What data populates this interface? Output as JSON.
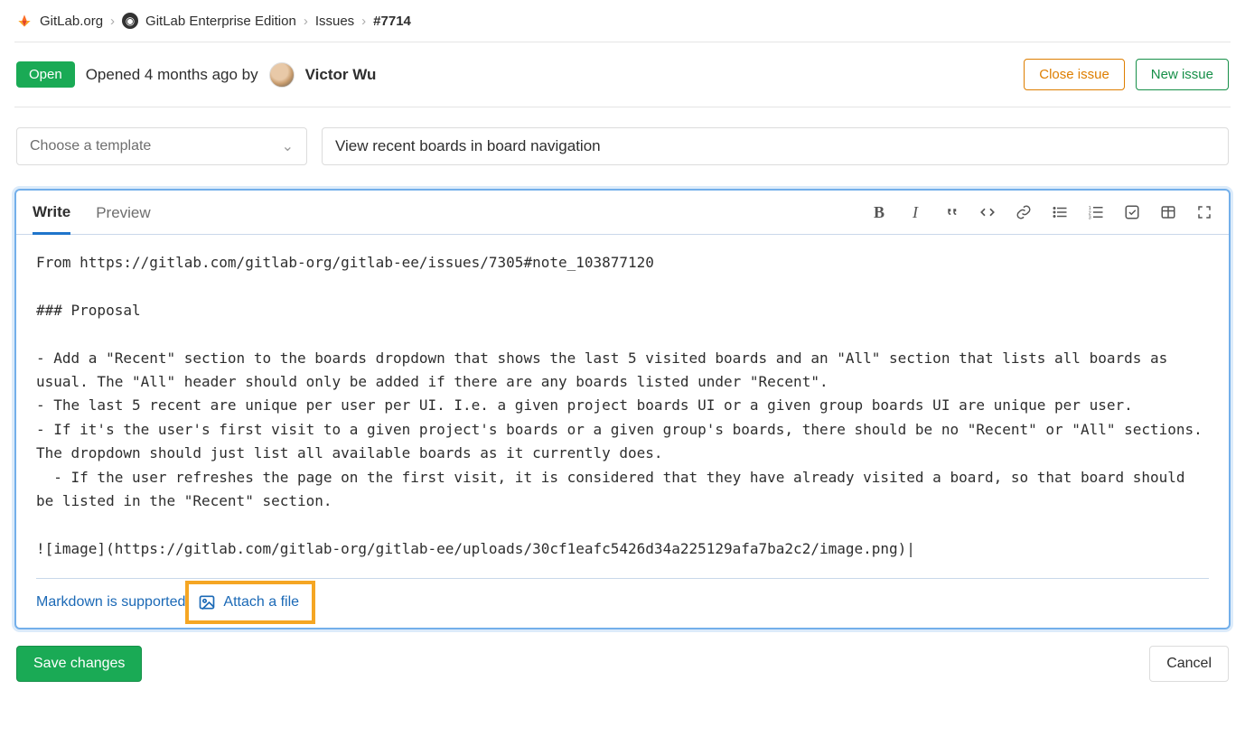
{
  "breadcrumb": {
    "org": "GitLab.org",
    "project": "GitLab Enterprise Edition",
    "section": "Issues",
    "id": "#7714"
  },
  "issue": {
    "state": "Open",
    "opened_text": "Opened 4 months ago by",
    "author": "Victor Wu"
  },
  "actions": {
    "close": "Close issue",
    "new": "New issue",
    "save": "Save changes",
    "cancel": "Cancel"
  },
  "form": {
    "template_placeholder": "Choose a template",
    "title": "View recent boards in board navigation"
  },
  "editor": {
    "tabs": {
      "write": "Write",
      "preview": "Preview"
    },
    "body": "From https://gitlab.com/gitlab-org/gitlab-ee/issues/7305#note_103877120\n\n### Proposal\n\n- Add a \"Recent\" section to the boards dropdown that shows the last 5 visited boards and an \"All\" section that lists all boards as usual. The \"All\" header should only be added if there are any boards listed under \"Recent\".\n- The last 5 recent are unique per user per UI. I.e. a given project boards UI or a given group boards UI are unique per user.\n- If it's the user's first visit to a given project's boards or a given group's boards, there should be no \"Recent\" or \"All\" sections. The dropdown should just list all available boards as it currently does.\n  - If the user refreshes the page on the first visit, it is considered that they have already visited a board, so that board should be listed in the \"Recent\" section.\n\n![image](https://gitlab.com/gitlab-org/gitlab-ee/uploads/30cf1eafc5426d34a225129afa7ba2c2/image.png)|",
    "markdown_link": "Markdown is supported",
    "attach": "Attach a file"
  }
}
